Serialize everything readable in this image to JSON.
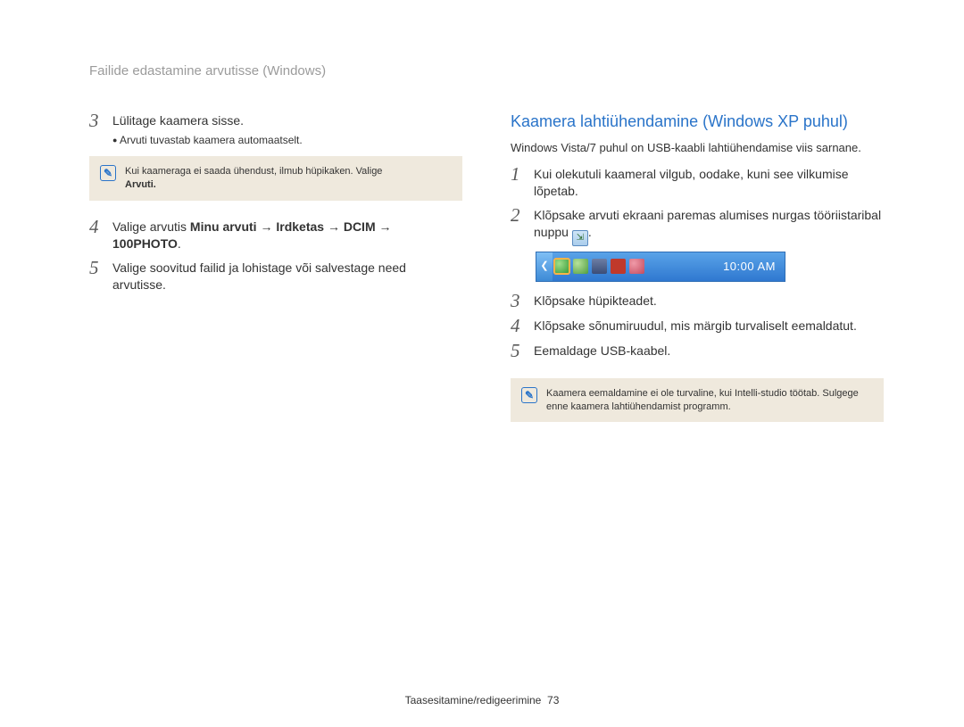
{
  "page_header": "Failide edastamine arvutisse (Windows)",
  "left": {
    "steps": [
      {
        "num": "3",
        "text": "Lülitage kaamera sisse.",
        "bullets": [
          "Arvuti tuvastab kaamera automaatselt."
        ],
        "note": {
          "line1": "Kui kaameraga ei saada ühendust, ilmub hüpikaken. Valige",
          "bold": "Arvuti."
        }
      },
      {
        "num": "4",
        "text_pre": "Valige arvutis ",
        "bold": "Minu arvuti → Irdketas → DCIM → 100PHOTO",
        "text_post": "."
      },
      {
        "num": "5",
        "text": "Valige soovitud failid ja lohistage või salvestage need arvutisse."
      }
    ]
  },
  "right": {
    "heading": "Kaamera lahtiühendamine (Windows XP puhul)",
    "intro": "Windows Vista/7 puhul on USB-kaabli lahtiühendamise viis sarnane.",
    "steps": [
      {
        "num": "1",
        "text": "Kui olekutuli kaameral vilgub, oodake, kuni see vilkumise lõpetab."
      },
      {
        "num": "2",
        "text_pre": "Klõpsake arvuti ekraani paremas alumises nurgas tööriistaribal nuppu ",
        "text_post": "."
      },
      {
        "num": "3",
        "text": "Klõpsake hüpikteadet."
      },
      {
        "num": "4",
        "text": "Klõpsake sõnumiruudul, mis märgib turvaliselt eemaldatut."
      },
      {
        "num": "5",
        "text": "Eemaldage USB-kaabel."
      }
    ],
    "taskbar_time": "10:00 AM",
    "note": "Kaamera eemaldamine ei ole turvaline, kui Intelli-studio töötab. Sulgege enne kaamera lahtiühendamist programm."
  },
  "footer": {
    "section": "Taasesitamine/redigeerimine",
    "page": "73"
  },
  "icons": {
    "note_glyph": "✎",
    "safely_remove_glyph": "⇲",
    "arrow_glyph": "❮"
  }
}
